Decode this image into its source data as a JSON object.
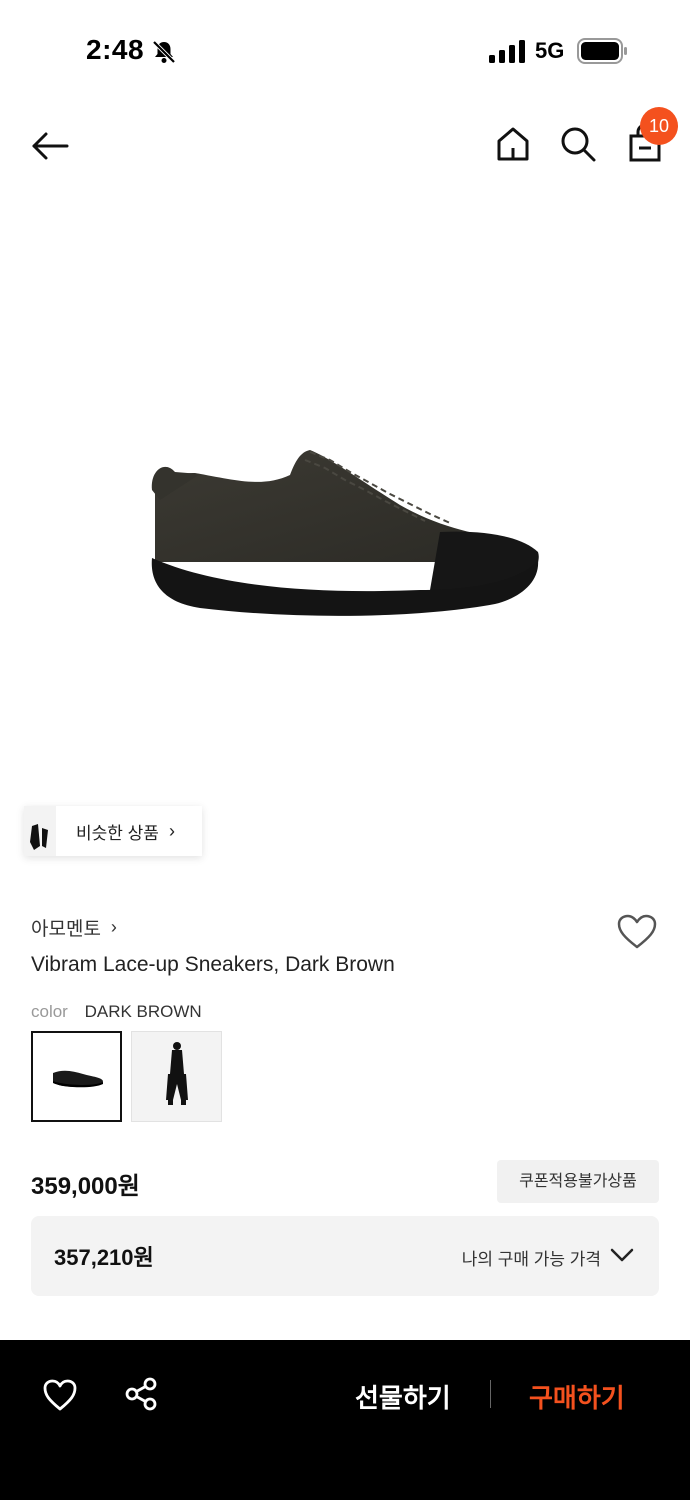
{
  "status_bar": {
    "time": "2:48",
    "network": "5G"
  },
  "nav": {
    "cart_count": "10",
    "icons": [
      "back-arrow-icon",
      "home-icon",
      "search-icon",
      "shopping-bag-icon"
    ]
  },
  "similar": {
    "label": "비슷한 상품",
    "chevron": "›"
  },
  "product": {
    "brand": "아모멘토",
    "brand_chevron": "›",
    "title": "Vibram Lace-up Sneakers, Dark Brown",
    "color_label": "color",
    "color_value": "DARK BROWN",
    "price": "359,000원",
    "coupon_label": "쿠폰적용불가상품",
    "my_price": "357,210원",
    "my_price_label": "나의 구매 가능 가격"
  },
  "bottom_bar": {
    "gift_label": "선물하기",
    "buy_label": "구매하기"
  },
  "colors": {
    "accent": "#f4511e",
    "bottom_bar_bg": "#000000"
  }
}
